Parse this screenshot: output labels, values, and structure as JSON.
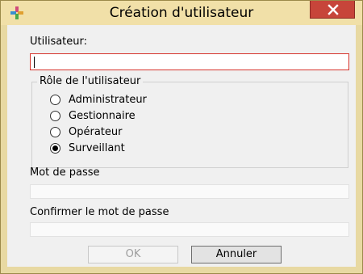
{
  "window": {
    "title": "Création d'utilisateur",
    "close_label": "close"
  },
  "form": {
    "user_label": "Utilisateur:",
    "user_value": "",
    "role_group_label": "Rôle de l'utilisateur",
    "roles": [
      {
        "label": "Administrateur",
        "selected": false
      },
      {
        "label": "Gestionnaire",
        "selected": false
      },
      {
        "label": "Opérateur",
        "selected": false
      },
      {
        "label": "Surveillant",
        "selected": true
      }
    ],
    "password_label": "Mot de passe",
    "confirm_label": "Confirmer le mot de passe"
  },
  "buttons": {
    "ok_label": "OK",
    "cancel_label": "Annuler"
  },
  "colors": {
    "frame": "#e8d9a2",
    "close_button": "#c7453a",
    "user_input_border": "#d6342c"
  }
}
